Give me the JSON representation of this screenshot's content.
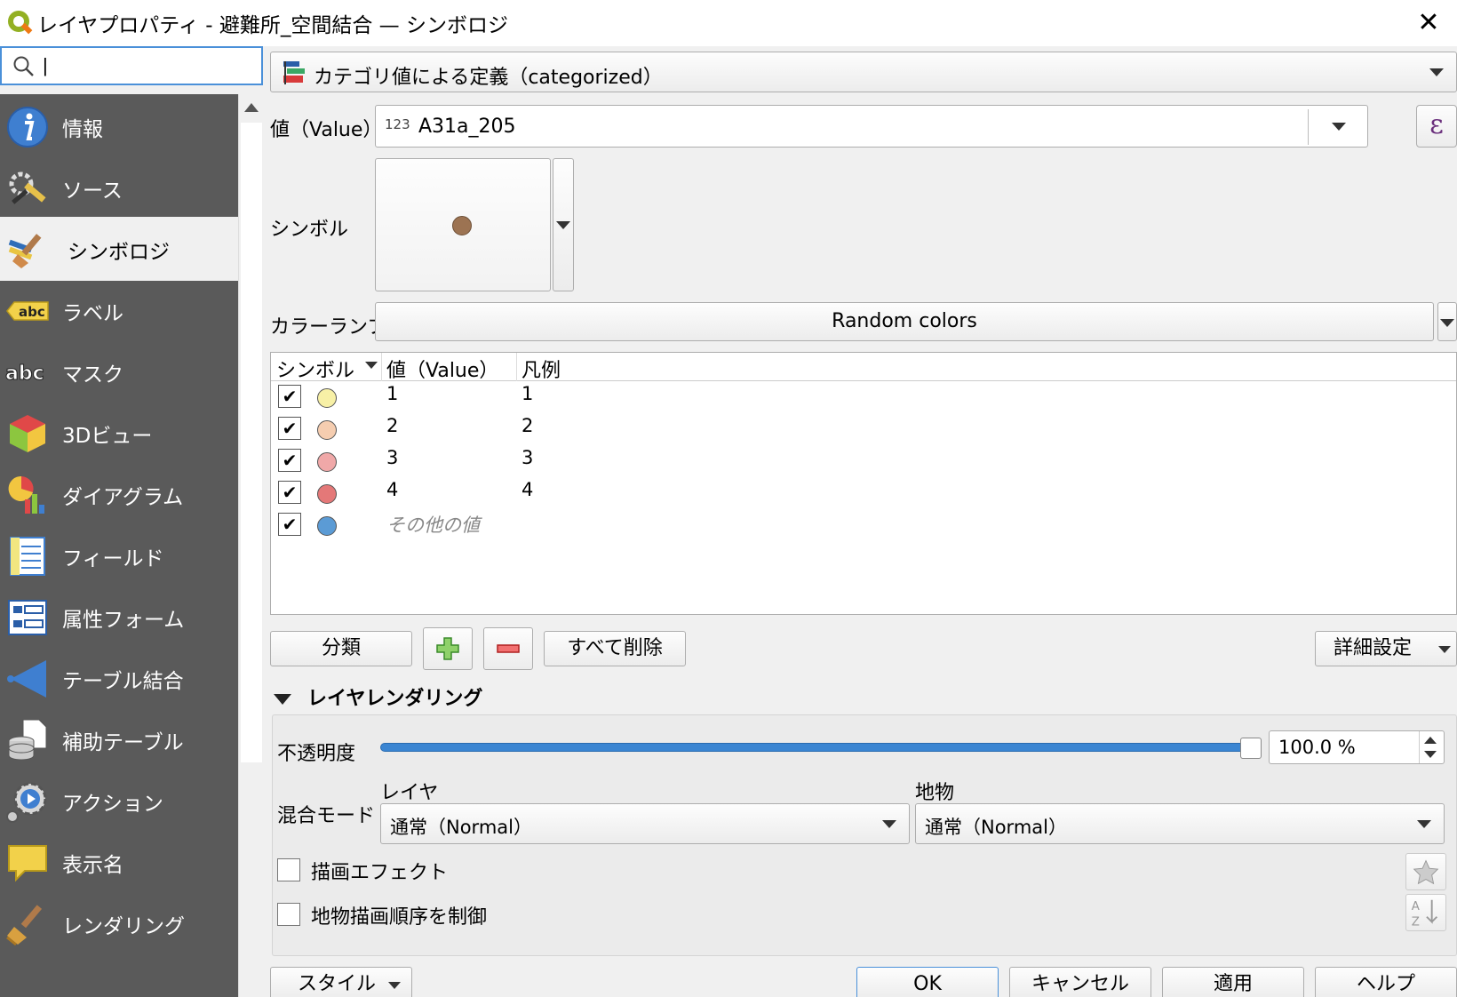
{
  "window": {
    "title": "レイヤプロパティ - 避難所_空間結合 — シンボロジ",
    "close_label": "✕"
  },
  "search": {
    "value": "|",
    "placeholder": ""
  },
  "sidebar": {
    "items": [
      {
        "label": "情報",
        "icon": "info-icon"
      },
      {
        "label": "ソース",
        "icon": "source-tools-icon"
      },
      {
        "label": "シンボロジ",
        "icon": "paintbrush-icon",
        "active": true
      },
      {
        "label": "ラベル",
        "icon": "label-abc-icon"
      },
      {
        "label": "マスク",
        "icon": "mask-abc-icon"
      },
      {
        "label": "3Dビュー",
        "icon": "cube-3d-icon"
      },
      {
        "label": "ダイアグラム",
        "icon": "diagram-icon"
      },
      {
        "label": "フィールド",
        "icon": "fields-icon"
      },
      {
        "label": "属性フォーム",
        "icon": "attribute-form-icon"
      },
      {
        "label": "テーブル結合",
        "icon": "join-icon"
      },
      {
        "label": "補助テーブル",
        "icon": "auxiliary-storage-icon"
      },
      {
        "label": "アクション",
        "icon": "action-gear-icon"
      },
      {
        "label": "表示名",
        "icon": "display-speech-icon"
      },
      {
        "label": "レンダリング",
        "icon": "rendering-brush-icon"
      }
    ]
  },
  "renderer": {
    "label": "カテゴリ値による定義（categorized）"
  },
  "value": {
    "label": "値（Value）",
    "type_badge": "123",
    "field": "A31a_205",
    "expr_label": "ε"
  },
  "symbol": {
    "label": "シンボル",
    "color": "#9c7352"
  },
  "color_ramp": {
    "label": "カラーランプ",
    "value": "Random colors"
  },
  "table": {
    "headers": {
      "symbol": "シンボル",
      "value": "値（Value）",
      "legend": "凡例"
    },
    "rows": [
      {
        "checked": "✔",
        "color": "#f7f0a6",
        "value": "1",
        "legend": "1"
      },
      {
        "checked": "✔",
        "color": "#f5cdb0",
        "value": "2",
        "legend": "2"
      },
      {
        "checked": "✔",
        "color": "#f0a8a8",
        "value": "3",
        "legend": "3"
      },
      {
        "checked": "✔",
        "color": "#e47878",
        "value": "4",
        "legend": "4"
      },
      {
        "checked": "✔",
        "color": "#5b9bd5",
        "value": "その他の値",
        "legend": ""
      }
    ]
  },
  "buttons": {
    "classify": "分類",
    "delete_all": "すべて削除",
    "advanced": "詳細設定"
  },
  "layer_rendering": {
    "title": "レイヤレンダリング",
    "opacity_label": "不透明度",
    "opacity_value": "100.0 %",
    "opacity": 1.0,
    "blend_label": "混合モード",
    "layer_label": "レイヤ",
    "feature_label": "地物",
    "layer_blend": "通常（Normal）",
    "feature_blend": "通常（Normal）",
    "draw_effects": "描画エフェクト",
    "order_control": "地物描画順序を制御"
  },
  "footer": {
    "style": "スタイル",
    "ok": "OK",
    "cancel": "キャンセル",
    "apply": "適用",
    "help": "ヘルプ"
  }
}
